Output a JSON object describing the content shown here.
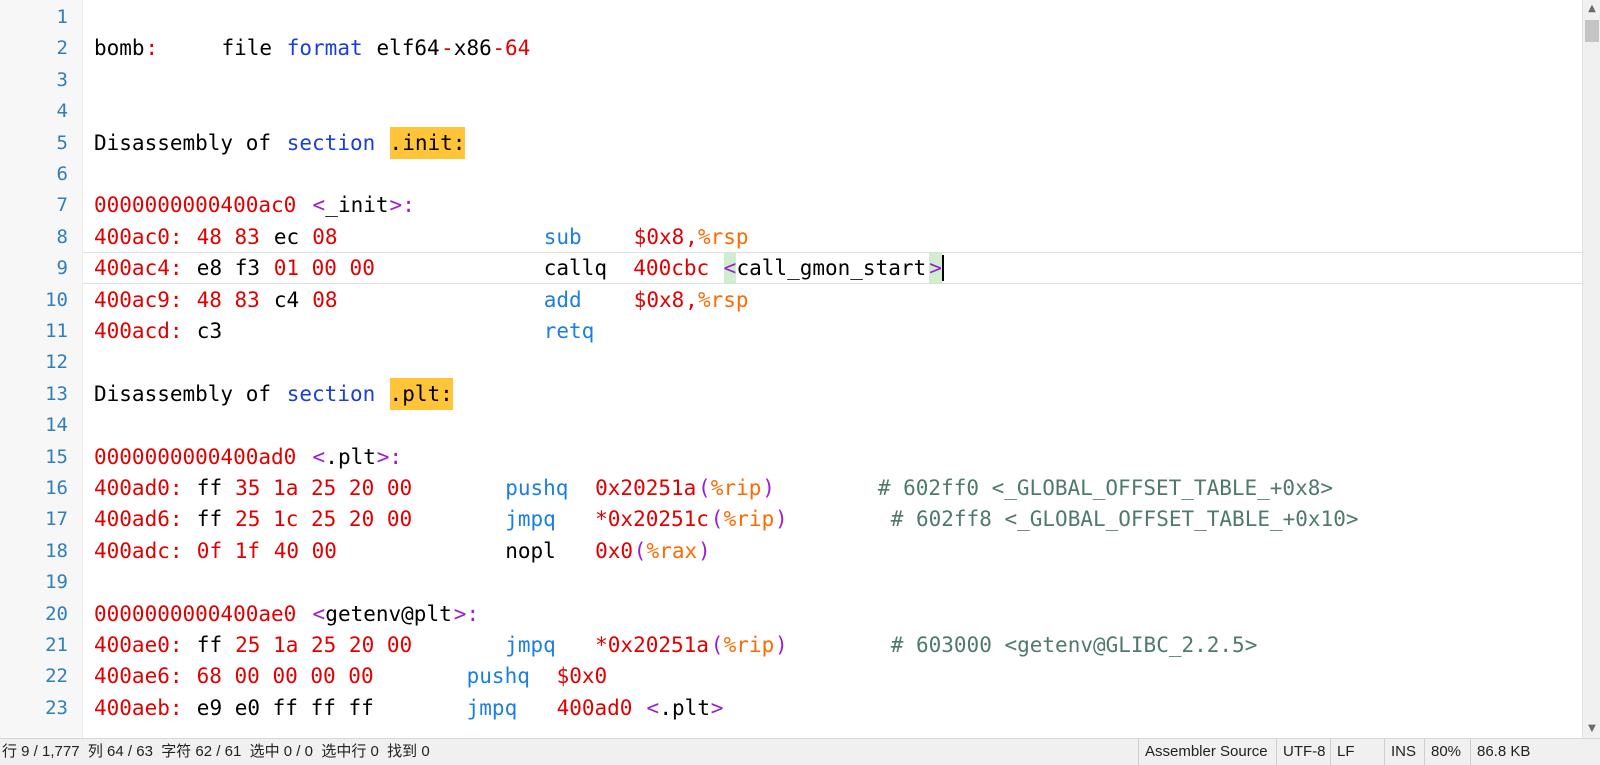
{
  "editor": {
    "line_numbers": [
      "1",
      "2",
      "3",
      "4",
      "5",
      "6",
      "7",
      "8",
      "9",
      "10",
      "11",
      "12",
      "13",
      "14",
      "15",
      "16",
      "17",
      "18",
      "19",
      "20",
      "21",
      "22",
      "23"
    ],
    "lines": [
      [],
      [
        [
          "bomb",
          "k"
        ],
        [
          ":",
          "red"
        ],
        [
          "     file ",
          "k"
        ],
        [
          "format",
          "blue"
        ],
        [
          " elf64",
          "k"
        ],
        [
          "-",
          "red"
        ],
        [
          "x86",
          "k"
        ],
        [
          "-64",
          "red"
        ]
      ],
      [],
      [],
      [
        [
          "Disassembly of ",
          "k"
        ],
        [
          "section",
          "blue"
        ],
        [
          " ",
          "k"
        ],
        [
          ".init:",
          "hl"
        ]
      ],
      [],
      [
        [
          "0000000000400ac0",
          "red"
        ],
        [
          " ",
          "k"
        ],
        [
          "<",
          "pur"
        ],
        [
          "_init",
          "k"
        ],
        [
          ">:",
          "pur"
        ]
      ],
      [
        [
          "400ac0:",
          "red"
        ],
        [
          " 48 83 ",
          "red"
        ],
        [
          "ec",
          "k"
        ],
        [
          " 08",
          "red"
        ],
        [
          "                ",
          "k"
        ],
        [
          "sub",
          "ins"
        ],
        [
          "    ",
          "k"
        ],
        [
          "$0x8",
          "red"
        ],
        [
          ",",
          "red"
        ],
        [
          "%rsp",
          "org"
        ]
      ],
      [
        [
          "400ac4:",
          "red"
        ],
        [
          " ",
          "k"
        ],
        [
          "e8 f3",
          "k"
        ],
        [
          " 01 00 00",
          "red"
        ],
        [
          "             ",
          "k"
        ],
        [
          "callq",
          "k"
        ],
        [
          "  400cbc ",
          "red"
        ],
        [
          "<",
          "br"
        ],
        [
          "call_gmon_start",
          "k"
        ],
        [
          ">",
          "br"
        ]
      ],
      [
        [
          "400ac9:",
          "red"
        ],
        [
          " 48 83 ",
          "red"
        ],
        [
          "c4",
          "k"
        ],
        [
          " 08",
          "red"
        ],
        [
          "                ",
          "k"
        ],
        [
          "add",
          "ins"
        ],
        [
          "    ",
          "k"
        ],
        [
          "$0x8",
          "red"
        ],
        [
          ",",
          "red"
        ],
        [
          "%rsp",
          "org"
        ]
      ],
      [
        [
          "400acd:",
          "red"
        ],
        [
          " ",
          "k"
        ],
        [
          "c3",
          "k"
        ],
        [
          "                         ",
          "k"
        ],
        [
          "retq",
          "ins"
        ]
      ],
      [],
      [
        [
          "Disassembly of ",
          "k"
        ],
        [
          "section",
          "blue"
        ],
        [
          " ",
          "k"
        ],
        [
          ".plt:",
          "hl"
        ]
      ],
      [],
      [
        [
          "0000000000400ad0",
          "red"
        ],
        [
          " ",
          "k"
        ],
        [
          "<",
          "pur"
        ],
        [
          ".plt",
          "k"
        ],
        [
          ">:",
          "pur"
        ]
      ],
      [
        [
          "400ad0:",
          "red"
        ],
        [
          " ",
          "k"
        ],
        [
          "ff",
          "k"
        ],
        [
          " 35 1a 25 20 00",
          "red"
        ],
        [
          "       ",
          "k"
        ],
        [
          "pushq",
          "ins"
        ],
        [
          "  ",
          "k"
        ],
        [
          "0x20251a",
          "red"
        ],
        [
          "(",
          "pur"
        ],
        [
          "%rip",
          "org"
        ],
        [
          ")",
          "pur"
        ],
        [
          "        ",
          "k"
        ],
        [
          "# 602ff0 <_GLOBAL_OFFSET_TABLE_+0x8>",
          "cmt"
        ]
      ],
      [
        [
          "400ad6:",
          "red"
        ],
        [
          " ",
          "k"
        ],
        [
          "ff",
          "k"
        ],
        [
          " 25 1c 25 20 00",
          "red"
        ],
        [
          "       ",
          "k"
        ],
        [
          "jmpq",
          "ins"
        ],
        [
          "   ",
          "k"
        ],
        [
          "*0x20251c",
          "red"
        ],
        [
          "(",
          "pur"
        ],
        [
          "%rip",
          "org"
        ],
        [
          ")",
          "pur"
        ],
        [
          "        ",
          "k"
        ],
        [
          "# 602ff8 <_GLOBAL_OFFSET_TABLE_+0x10>",
          "cmt"
        ]
      ],
      [
        [
          "400adc:",
          "red"
        ],
        [
          " ",
          "k"
        ],
        [
          "0f 1f",
          "red"
        ],
        [
          " 40 00",
          "red"
        ],
        [
          "             ",
          "k"
        ],
        [
          "nopl",
          "k"
        ],
        [
          "   ",
          "k"
        ],
        [
          "0x0",
          "red"
        ],
        [
          "(",
          "pur"
        ],
        [
          "%rax",
          "org"
        ],
        [
          ")",
          "pur"
        ]
      ],
      [],
      [
        [
          "0000000000400ae0",
          "red"
        ],
        [
          " ",
          "k"
        ],
        [
          "<",
          "pur"
        ],
        [
          "getenv@plt",
          "k"
        ],
        [
          ">:",
          "pur"
        ]
      ],
      [
        [
          "400ae0:",
          "red"
        ],
        [
          " ",
          "k"
        ],
        [
          "ff",
          "k"
        ],
        [
          " 25 1a 25 20 00",
          "red"
        ],
        [
          "       ",
          "k"
        ],
        [
          "jmpq",
          "ins"
        ],
        [
          "   ",
          "k"
        ],
        [
          "*0x20251a",
          "red"
        ],
        [
          "(",
          "pur"
        ],
        [
          "%rip",
          "org"
        ],
        [
          ")",
          "pur"
        ],
        [
          "        ",
          "k"
        ],
        [
          "# 603000 <getenv@GLIBC_2.2.5>",
          "cmt"
        ]
      ],
      [
        [
          "400ae6:",
          "red"
        ],
        [
          " 68 00 00 00 00",
          "red"
        ],
        [
          "       ",
          "k"
        ],
        [
          "pushq",
          "ins"
        ],
        [
          "  ",
          "k"
        ],
        [
          "$0x0",
          "red"
        ]
      ],
      [
        [
          "400aeb:",
          "red"
        ],
        [
          " ",
          "k"
        ],
        [
          "e9 e0 ff ff ff",
          "k"
        ],
        [
          "       ",
          "k"
        ],
        [
          "jmpq",
          "ins"
        ],
        [
          "   ",
          "k"
        ],
        [
          "400ad0",
          "red"
        ],
        [
          " ",
          "k"
        ],
        [
          "<",
          "pur"
        ],
        [
          ".plt",
          "k"
        ],
        [
          ">",
          "pur"
        ]
      ]
    ],
    "current_line": 9
  },
  "statusbar": {
    "position": "行 9 / 1,777  列 64 / 63  字符 62 / 61  选中 0 / 0  选中行 0  找到 0",
    "language": "Assembler Source",
    "encoding": "UTF-8",
    "eol": "LF",
    "mode": "INS",
    "zoom": "80%",
    "size": "86.8 KB"
  },
  "scrollbar": {
    "up_icon": "▲",
    "down_icon": "▼"
  }
}
